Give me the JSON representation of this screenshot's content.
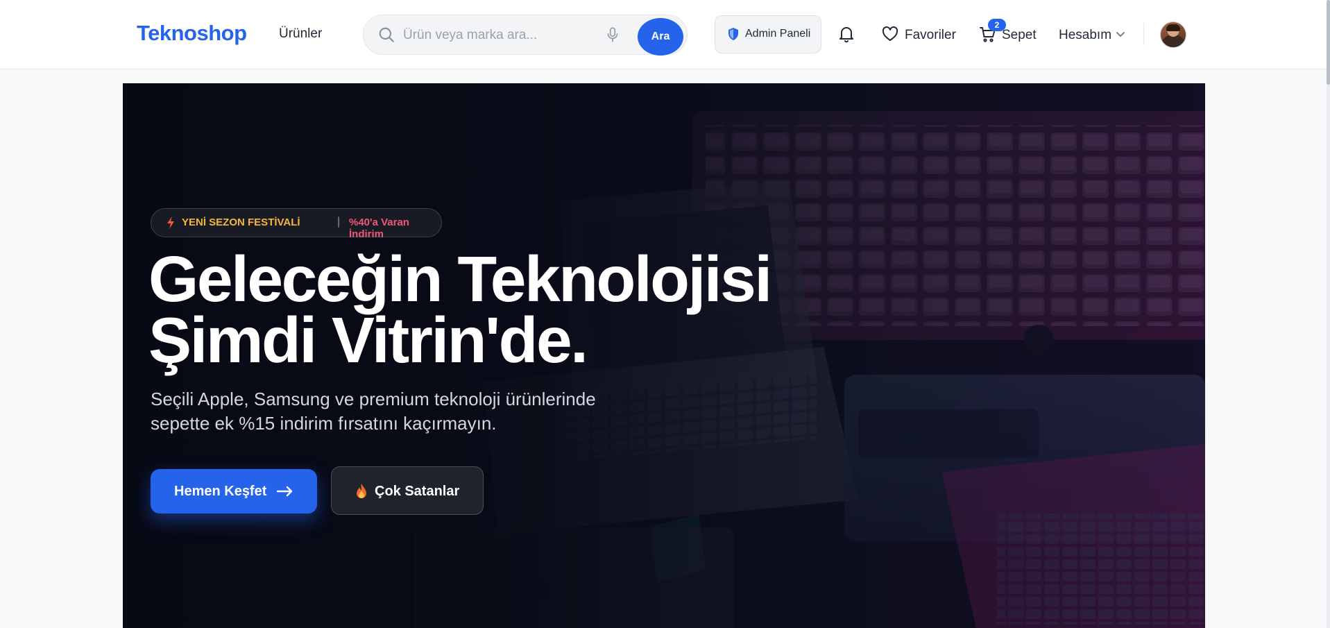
{
  "header": {
    "brand": "Teknoshop",
    "nav_products": "Ürünler",
    "search": {
      "placeholder": "Ürün veya marka ara...",
      "button_label": "Ara"
    },
    "admin_label": "Admin Paneli",
    "favorites_label": "Favoriler",
    "cart_label": "Sepet",
    "cart_count": "2",
    "account_label": "Hesabım",
    "icons": [
      "search-icon",
      "microphone-icon",
      "shield-icon",
      "bell-icon",
      "heart-icon",
      "cart-icon",
      "chevron-down-icon"
    ]
  },
  "hero": {
    "promo": {
      "season": "YENİ SEZON FESTİVALİ",
      "separator": "|",
      "discount": "%40'a Varan İndirim"
    },
    "title_line1": "Geleceğin Teknolojisi",
    "title_line2": "Şimdi Vitrin'de.",
    "subtitle": "Seçili Apple, Samsung ve premium teknoloji ürünlerinde sepette ek %15 indirim fırsatını kaçırmayın.",
    "cta_primary": "Hemen Keşfet",
    "cta_secondary": "Çok Satanlar"
  },
  "colors": {
    "accent": "#2563eb",
    "promo_yellow": "#f5b83a",
    "promo_pink": "#f0567a",
    "hero_bg": "#0c0f1c"
  }
}
